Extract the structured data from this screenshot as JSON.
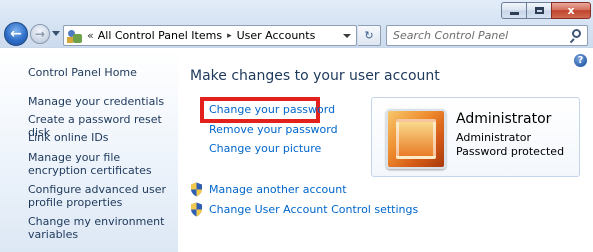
{
  "window": {
    "minimize_glyph": "",
    "maximize_glyph": "",
    "close_glyph": "x"
  },
  "nav": {
    "back_glyph": "←",
    "forward_glyph": "→"
  },
  "address": {
    "chevron": "«",
    "breadcrumbs": [
      "All Control Panel Items",
      "User Accounts"
    ],
    "separator": "▸"
  },
  "refresh_glyph": "↻",
  "search": {
    "placeholder": "Search Control Panel"
  },
  "sidebar": {
    "items": [
      {
        "label": "Control Panel Home"
      },
      {
        "label": "Manage your credentials"
      },
      {
        "label": "Create a password reset disk"
      },
      {
        "label": "Link online IDs"
      },
      {
        "label": "Manage your file encryption certificates"
      },
      {
        "label": "Configure advanced user profile properties"
      },
      {
        "label": "Change my environment variables"
      }
    ]
  },
  "main": {
    "help_glyph": "?",
    "title": "Make changes to your user account",
    "tasks": [
      {
        "label": "Change your password"
      },
      {
        "label": "Remove your password"
      },
      {
        "label": "Change your picture"
      }
    ],
    "shield_tasks": [
      {
        "label": "Manage another account"
      },
      {
        "label": "Change User Account Control settings"
      }
    ]
  },
  "account": {
    "name": "Administrator",
    "role": "Administrator",
    "status": "Password protected"
  },
  "colors": {
    "link": "#0066cc",
    "nav_text": "#1e395b",
    "highlight": "#e3211c"
  }
}
